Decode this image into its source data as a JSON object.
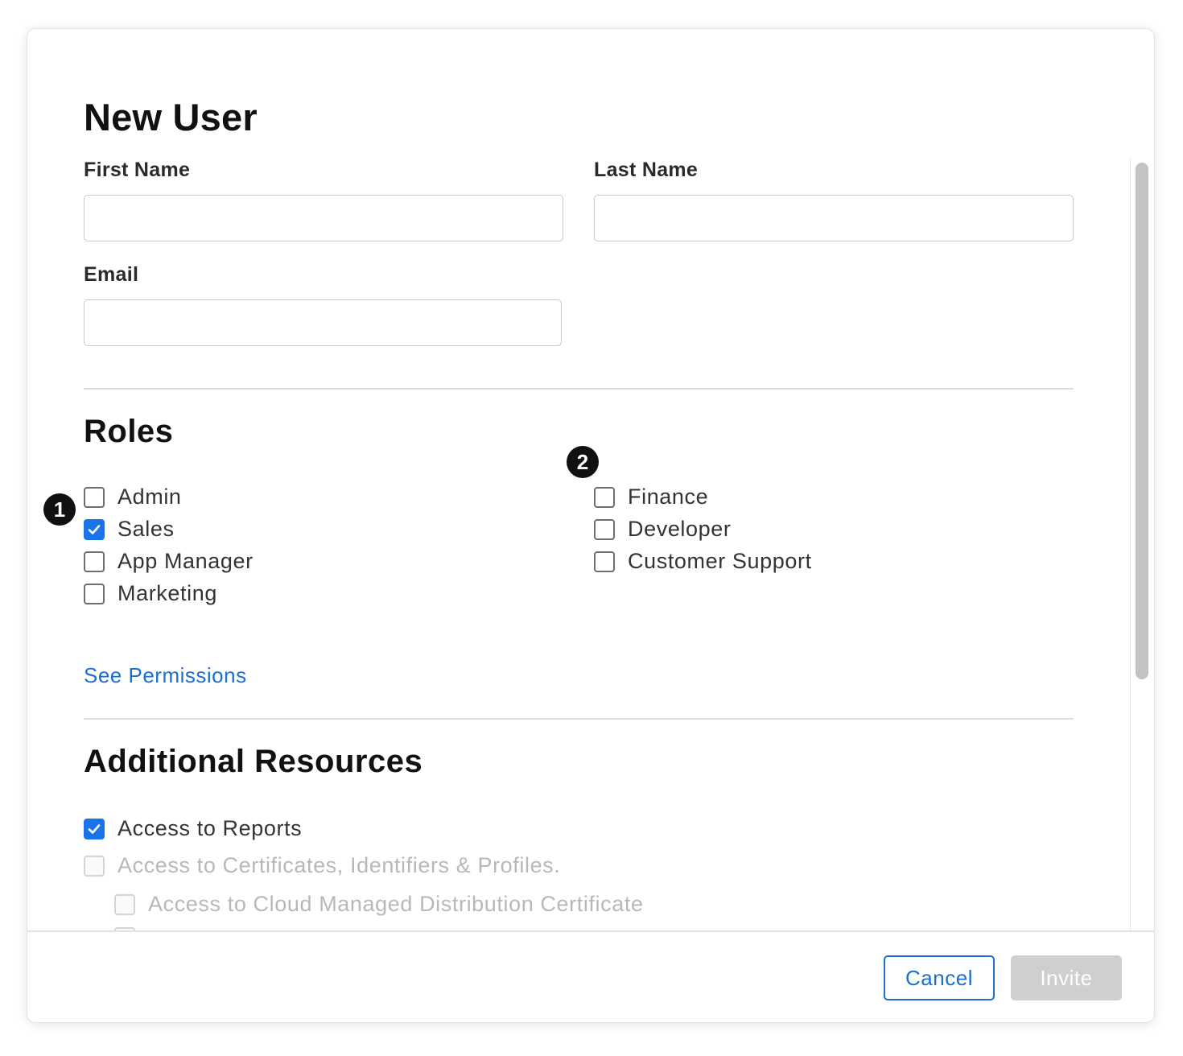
{
  "dialog": {
    "title": "New User"
  },
  "form": {
    "first_name": {
      "label": "First Name",
      "value": "",
      "placeholder": ""
    },
    "last_name": {
      "label": "Last Name",
      "value": "",
      "placeholder": ""
    },
    "email": {
      "label": "Email",
      "value": "",
      "placeholder": ""
    }
  },
  "roles": {
    "title": "Roles",
    "left_column": [
      {
        "label": "Admin",
        "checked": false
      },
      {
        "label": "Sales",
        "checked": true
      },
      {
        "label": "App Manager",
        "checked": false
      },
      {
        "label": "Marketing",
        "checked": false
      }
    ],
    "right_column": [
      {
        "label": "Finance",
        "checked": false
      },
      {
        "label": "Developer",
        "checked": false
      },
      {
        "label": "Customer Support",
        "checked": false
      }
    ],
    "see_permissions_label": "See Permissions",
    "callouts": [
      "1",
      "2"
    ]
  },
  "additional_resources": {
    "title": "Additional Resources",
    "items": [
      {
        "label": "Access to Reports",
        "checked": true,
        "disabled": false
      },
      {
        "label": "Access to Certificates, Identifiers & Profiles.",
        "checked": false,
        "disabled": true
      },
      {
        "label": "Access to Cloud Managed Distribution Certificate",
        "checked": false,
        "disabled": true
      }
    ]
  },
  "footer": {
    "cancel_label": "Cancel",
    "invite_label": "Invite",
    "invite_enabled": false
  },
  "colors": {
    "accent": "#1a73e8",
    "link": "#1a6fcf",
    "disabled_button": "#cfcfcf"
  }
}
